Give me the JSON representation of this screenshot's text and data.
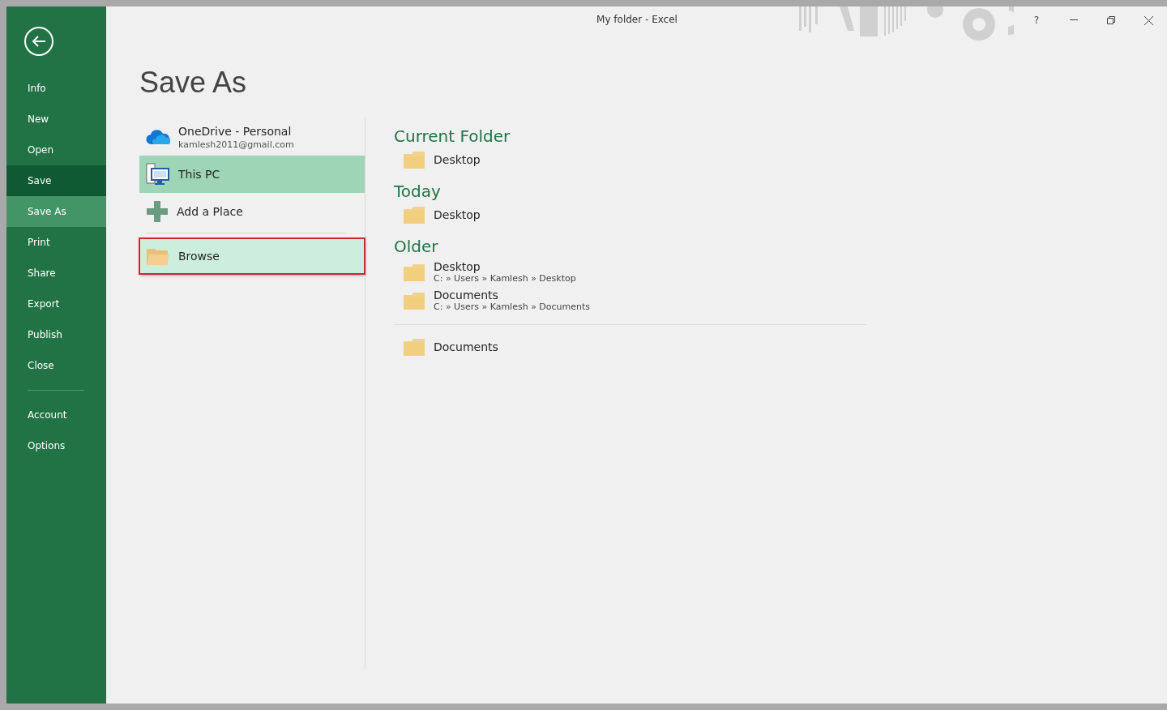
{
  "window": {
    "title": "My folder - Excel",
    "help": "?"
  },
  "sidebar": {
    "items": [
      {
        "label": "Info",
        "selected": false,
        "hovered": false
      },
      {
        "label": "New",
        "selected": false,
        "hovered": false
      },
      {
        "label": "Open",
        "selected": false,
        "hovered": false
      },
      {
        "label": "Save",
        "selected": false,
        "hovered": true
      },
      {
        "label": "Save As",
        "selected": true,
        "hovered": false
      },
      {
        "label": "Print",
        "selected": false,
        "hovered": false
      },
      {
        "label": "Share",
        "selected": false,
        "hovered": false
      },
      {
        "label": "Export",
        "selected": false,
        "hovered": false
      },
      {
        "label": "Publish",
        "selected": false,
        "hovered": false
      },
      {
        "label": "Close",
        "selected": false,
        "hovered": false
      }
    ],
    "bottom_items": [
      {
        "label": "Account",
        "selected": false,
        "hovered": false
      },
      {
        "label": "Options",
        "selected": false,
        "hovered": false
      }
    ]
  },
  "page_title": "Save As",
  "places": [
    {
      "kind": "cloud",
      "name": "OneDrive - Personal",
      "detail": "kamlesh2011@gmail.com",
      "selected": false,
      "hovered": false,
      "outlined": false
    },
    {
      "kind": "pc",
      "name": "This PC",
      "selected": true,
      "hovered": false,
      "outlined": false
    },
    {
      "kind": "add",
      "name": "Add a Place",
      "selected": false,
      "hovered": false,
      "outlined": false
    },
    {
      "kind": "browse",
      "name": "Browse",
      "selected": false,
      "hovered": true,
      "outlined": true
    }
  ],
  "folder_sections": [
    {
      "heading": "Current Folder",
      "items": [
        {
          "name": "Desktop"
        }
      ]
    },
    {
      "heading": "Today",
      "items": [
        {
          "name": "Desktop"
        }
      ]
    },
    {
      "heading": "Older",
      "items": [
        {
          "name": "Desktop",
          "path": "C: » Users » Kamlesh » Desktop"
        },
        {
          "name": "Documents",
          "path": "C: » Users » Kamlesh » Documents"
        }
      ]
    }
  ],
  "other_folders": [
    {
      "name": "Documents"
    }
  ]
}
